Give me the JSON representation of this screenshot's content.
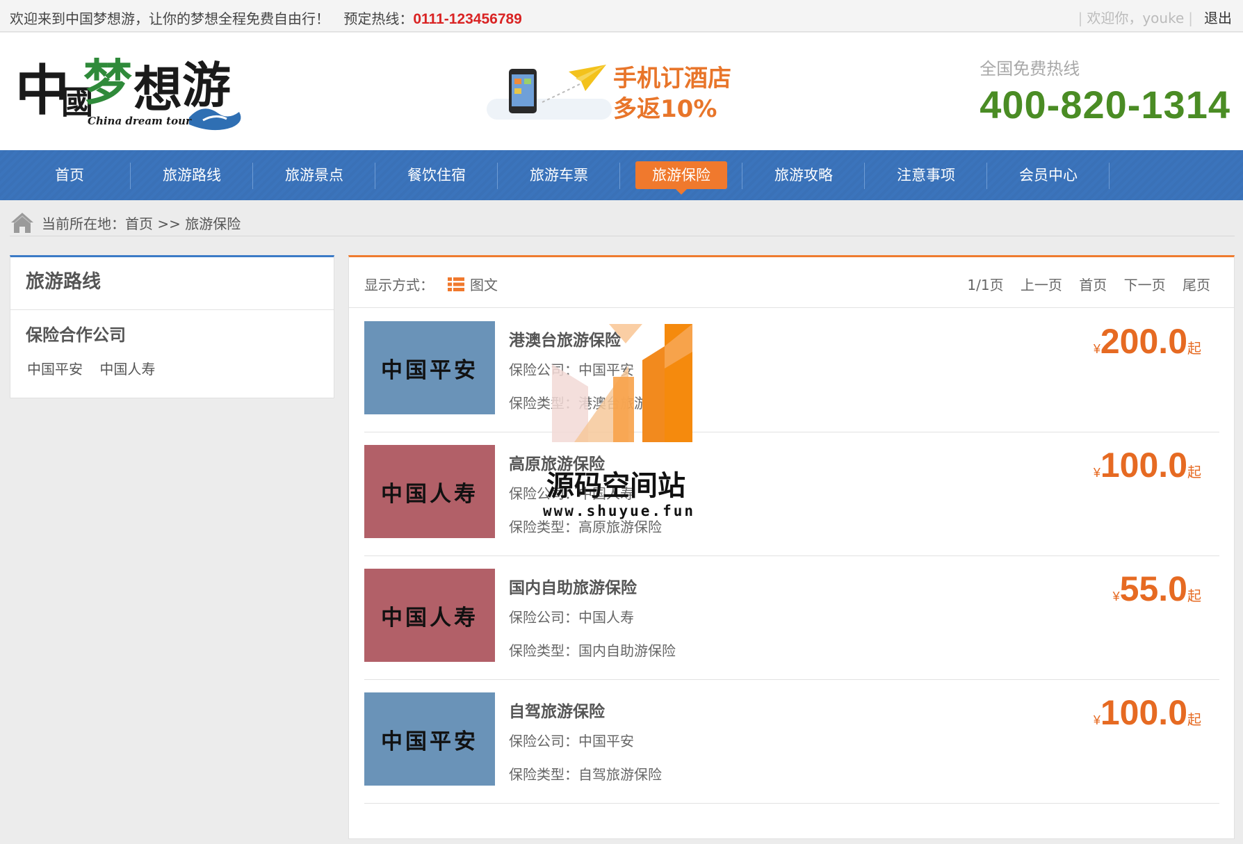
{
  "topbar": {
    "welcome": "欢迎来到中国梦想游，让你的梦想全程免费自由行！",
    "hotline_label": "预定热线：",
    "hotline_number": "0111-123456789",
    "user_greeting": "欢迎你，youke",
    "logout": "退出"
  },
  "header": {
    "logo_tagline": "China dream tour",
    "promo_line1": "手机订酒店",
    "promo_line2": "多返10%",
    "hotline_label": "全国免费热线",
    "hotline_number": "400-820-1314"
  },
  "nav": {
    "items": [
      {
        "label": "首页"
      },
      {
        "label": "旅游路线"
      },
      {
        "label": "旅游景点"
      },
      {
        "label": "餐饮住宿"
      },
      {
        "label": "旅游车票"
      },
      {
        "label": "旅游保险"
      },
      {
        "label": "旅游攻略"
      },
      {
        "label": "注意事项"
      },
      {
        "label": "会员中心"
      }
    ],
    "active": "旅游保险"
  },
  "breadcrumb": {
    "text": "当前所在地：首页 >> 旅游保险"
  },
  "sidebar": {
    "title": "旅游路线",
    "subtitle": "保险合作公司",
    "companies": [
      "中国平安",
      "中国人寿"
    ]
  },
  "toolbar": {
    "mode_label": "显示方式：",
    "mode_value": "图文",
    "page_info": "1/1页",
    "prev": "上一页",
    "first": "首页",
    "next": "下一页",
    "last": "尾页"
  },
  "items": [
    {
      "thumb_text": "中国平安",
      "thumb_color": "#6a93b8",
      "name": "港澳台旅游保险",
      "company": "保险公司：中国平安",
      "type": "保险类型：港澳台旅游保险",
      "currency": "¥",
      "price": "200.0",
      "suffix": "起"
    },
    {
      "thumb_text": "中国人寿",
      "thumb_color": "#b26068",
      "name": "高原旅游保险",
      "company": "保险公司：中国人寿",
      "type": "保险类型：高原旅游保险",
      "currency": "¥",
      "price": "100.0",
      "suffix": "起"
    },
    {
      "thumb_text": "中国人寿",
      "thumb_color": "#b26068",
      "name": "国内自助旅游保险",
      "company": "保险公司：中国人寿",
      "type": "保险类型：国内自助游保险",
      "currency": "¥",
      "price": "55.0",
      "suffix": "起"
    },
    {
      "thumb_text": "中国平安",
      "thumb_color": "#6a93b8",
      "name": "自驾旅游保险",
      "company": "保险公司：中国平安",
      "type": "保险类型：自驾旅游保险",
      "currency": "¥",
      "price": "100.0",
      "suffix": "起"
    }
  ],
  "watermark": {
    "text": "源码空间站",
    "url": "www.shuyue.fun"
  },
  "colors": {
    "nav_blue": "#3b74bc",
    "accent_orange": "#f0792d",
    "price_orange": "#e66a22",
    "hotline_green": "#4a8c24",
    "hotline_red": "#d92323"
  }
}
